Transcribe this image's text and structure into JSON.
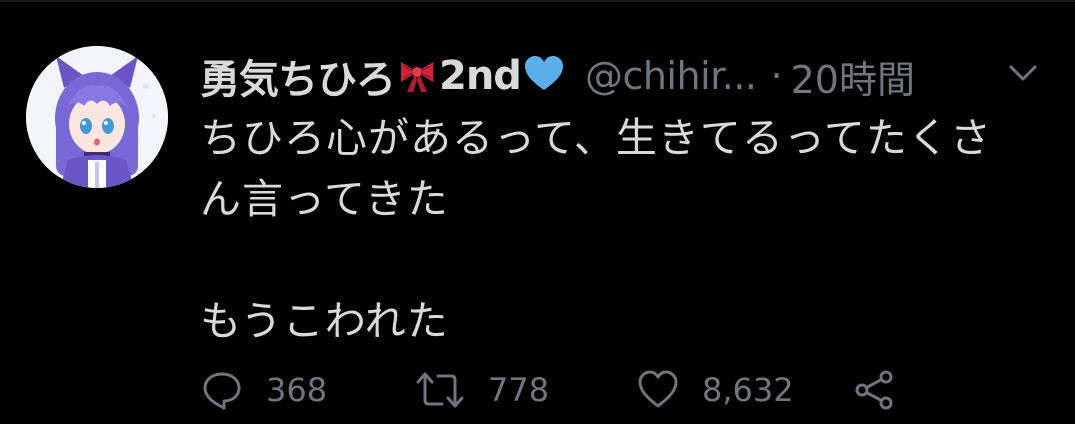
{
  "tweet": {
    "author": {
      "display_name": "勇気ちひろ",
      "name_suffix": "2nd",
      "handle": "@chihir...",
      "separator": "·",
      "timestamp": "20時間"
    },
    "text_lines": [
      "ちひろ心があるって、生きてるってたくさ",
      "ん言ってきた",
      "",
      "もうこわれた"
    ],
    "actions": {
      "replies": "368",
      "retweets": "778",
      "likes": "8,632"
    }
  },
  "icons": {
    "menu": "chevron-down-icon",
    "reply": "comment-icon",
    "retweet": "retweet-icon",
    "like": "heart-icon",
    "share": "share-icon",
    "name_emoji_1": "ribbon-icon",
    "name_emoji_2": "blue-heart-icon"
  },
  "colors": {
    "background": "#000000",
    "text": "#d9d9d9",
    "muted": "#6e767d",
    "ribbon": "#d4223a",
    "blue_heart": "#5aaee9"
  }
}
